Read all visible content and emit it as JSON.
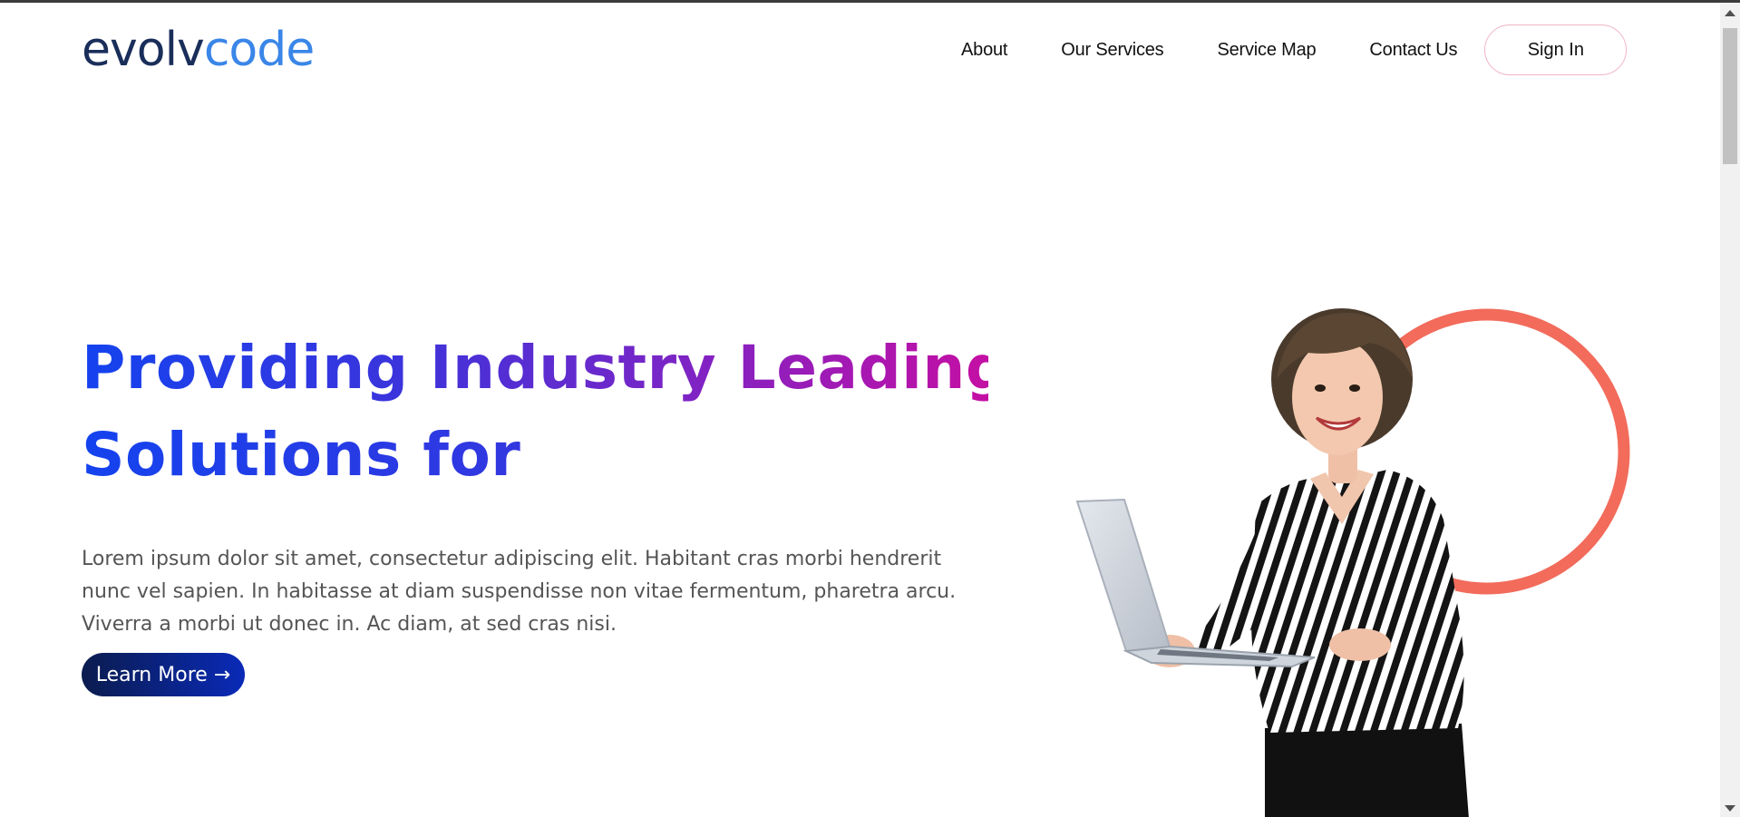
{
  "header": {
    "logo": {
      "part1": "evolv",
      "part2": "code"
    },
    "nav": [
      {
        "label": "About"
      },
      {
        "label": "Our Services"
      },
      {
        "label": "Service Map"
      },
      {
        "label": "Contact Us"
      }
    ],
    "signin_label": "Sign In"
  },
  "hero": {
    "headline_line1": "Providing Industry Leading",
    "headline_line2": "Solutions for",
    "description": "Lorem ipsum dolor sit amet, consectetur adipiscing elit. Habitant cras morbi hendrerit nunc vel sapien. In habitasse at diam suspendisse non vitae fermentum, pharetra arcu. Viverra a morbi ut donec in. Ac diam, at sed cras nisi.",
    "cta_label": "Learn More →"
  },
  "colors": {
    "logo_dark": "#1a2e5a",
    "logo_accent": "#3a86e8",
    "headline_start": "#1443ee",
    "headline_end": "#c40fa4",
    "cta_start": "#0b1c4e",
    "cta_end": "#0a2ab8",
    "ring": "#f26b5b",
    "signin_border": "#f2b5c4"
  },
  "icons": {
    "scroll_up": "scroll-up-arrow-icon",
    "scroll_down": "scroll-down-arrow-icon"
  }
}
